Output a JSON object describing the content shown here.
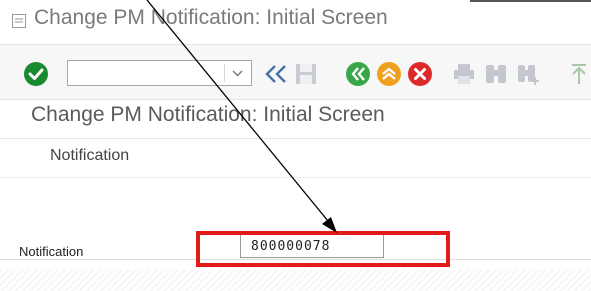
{
  "window": {
    "title": "Change PM Notification: Initial Screen"
  },
  "toolbar": {
    "command_field_value": "",
    "icons": [
      "enter-icon",
      "command-dropdown-icon",
      "collapse-double-left-icon",
      "save-icon",
      "back-icon",
      "exit-icon",
      "cancel-icon",
      "print-icon",
      "find-icon",
      "find-next-icon",
      "first-page-icon"
    ]
  },
  "screen": {
    "title": "Change PM Notification: Initial Screen"
  },
  "menu": {
    "items": [
      {
        "label": "Notification"
      }
    ]
  },
  "form": {
    "notification_label": "Notification",
    "notification_value": "800000078"
  },
  "colors": {
    "highlight": "#e21a1a",
    "enter_green": "#1a8a2f",
    "nav_back": "#3aa64a",
    "nav_exit": "#f0a020",
    "nav_cancel": "#dc2a2a"
  }
}
